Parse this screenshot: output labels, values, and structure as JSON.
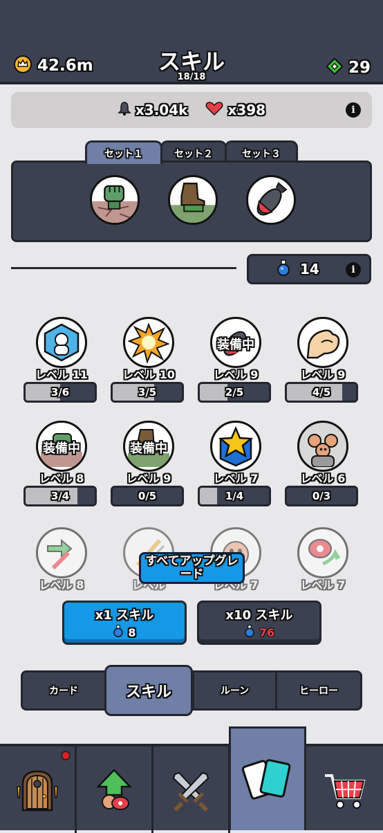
{
  "header": {
    "gold": "42.6m",
    "title": "スキル",
    "count": "18/18",
    "gems": "29"
  },
  "stats": {
    "bell": "x3.04k",
    "heart": "x398"
  },
  "sets": [
    "セット１",
    "セット２",
    "セット３"
  ],
  "potion": "14",
  "skills": [
    {
      "level": "レベル 11",
      "progress": "3/6",
      "fill": 0.5
    },
    {
      "level": "レベル 10",
      "progress": "3/5",
      "fill": 0.6
    },
    {
      "level": "レベル 9",
      "progress": "2/5",
      "fill": 0.4,
      "equipped": "装備中"
    },
    {
      "level": "レベル 9",
      "progress": "4/5",
      "fill": 0.8
    },
    {
      "level": "レベル 8",
      "progress": "3/4",
      "fill": 0.75,
      "equipped": "装備中"
    },
    {
      "level": "レベル 9",
      "progress": "0/5",
      "fill": 0,
      "equipped": "装備中"
    },
    {
      "level": "レベル 7",
      "progress": "1/4",
      "fill": 0.25
    },
    {
      "level": "レベル 6",
      "progress": "0/3",
      "fill": 0
    },
    {
      "level": "レベル 8"
    },
    {
      "level": "レベル"
    },
    {
      "level": "レベル 7"
    },
    {
      "level": "レベル 7"
    }
  ],
  "upgrade_all": "すべてアップグレード",
  "buy": {
    "x1": {
      "label": "x1 スキル",
      "cost": "8"
    },
    "x10": {
      "label": "x10 スキル",
      "cost": "76"
    }
  },
  "tabs": [
    "カード",
    "スキル",
    "ルーン",
    "ヒーロー"
  ],
  "colors": {
    "accent_blue": "#1598e6",
    "panel": "#3c4152",
    "active": "#6f7fa6",
    "cost_red": "#e8404a"
  }
}
